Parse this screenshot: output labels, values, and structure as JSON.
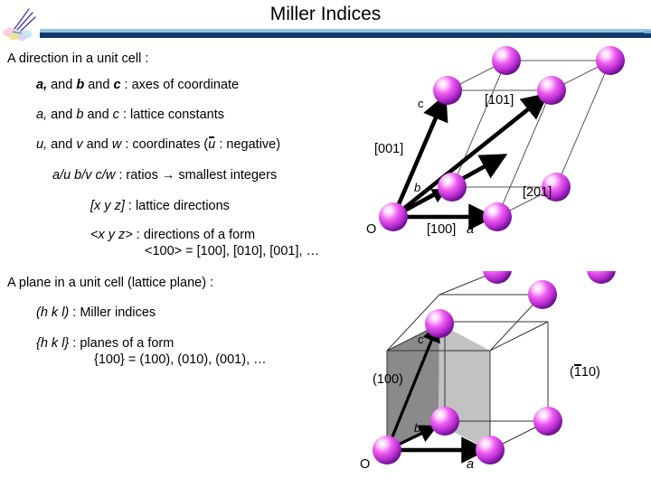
{
  "header": {
    "title": "Miller Indices",
    "logo_icon": "paintbrush-clipart-icon",
    "rule_light_color": "#95c5e4",
    "rule_dark_color": "#133a6b"
  },
  "section_direction": {
    "heading": "A direction in a unit cell :",
    "lines": [
      {
        "id": "axes",
        "bold_part": "a, b",
        "rest": ""
      },
      {
        "id": "lattice",
        "text": ""
      },
      {
        "id": "coords",
        "text": ""
      },
      {
        "id": "ratios",
        "text": ""
      },
      {
        "id": "brackets",
        "text": ""
      },
      {
        "id": "form",
        "text": ""
      }
    ],
    "line_axes_a": "a,",
    "line_axes_b": "b",
    "line_axes_and": " and ",
    "line_axes_c": "c",
    "line_axes_tail": " :  axes of  coordinate",
    "line_lattice_a": "a,",
    "line_lattice_b": "b",
    "line_lattice_c": "c",
    "line_lattice_tail": " :  lattice constants",
    "line_coords_u": "u,",
    "line_coords_v": "v",
    "line_coords_w": "w",
    "line_coords_mid": " :  coordinates (",
    "line_coords_ubar": "u",
    "line_coords_tail": " :  negative)",
    "line_ratios_math": "a/u b/v c/w",
    "line_ratios_tail": " :  ratios → smallest integers",
    "line_brackets_math": "[x y z]",
    "line_brackets_tail": " :  lattice directions",
    "line_form_math": "<x y z>",
    "line_form_tail": "  :  directions of a form",
    "line_form_example": "<100> = [100], [010], [001], …"
  },
  "section_plane": {
    "heading": "A plane in a unit cell (lattice plane) :",
    "line_miller_math": "(h k l)",
    "line_miller_tail": " :  Miller indices",
    "line_formset_math": "{h k l}",
    "line_formset_tail": " :  planes of a form",
    "line_formset_example": "{100} = (100), (010), (001), …"
  },
  "diagram_directions": {
    "name": "unit-cell-directions-diagram",
    "atom_color_core": "#e055e0",
    "atom_color_edge": "#7a1f9c",
    "atom_color_highlight": "#ffe9ff",
    "edge_color": "#555555",
    "vector_color": "#000000",
    "labels": {
      "origin": "O",
      "axis_a": "a",
      "axis_b": "b",
      "axis_c": "c",
      "dir_001": "[001]",
      "dir_101": "[101]",
      "dir_201": "[201]",
      "dir_100": "[100]"
    }
  },
  "diagram_planes": {
    "name": "unit-cell-planes-diagram",
    "atom_color_core": "#e055e0",
    "atom_color_edge": "#7a1f9c",
    "plane_color_dark": "#8a8a8a",
    "plane_color_light": "#c2c2c2",
    "edge_color": "#333333",
    "labels": {
      "origin": "O",
      "axis_a": "a",
      "axis_b": "b",
      "axis_c": "c",
      "plane_100": "(100)",
      "plane_1bar10_open": "(",
      "plane_1bar10_bar": "1",
      "plane_1bar10_rest": "10)"
    }
  }
}
